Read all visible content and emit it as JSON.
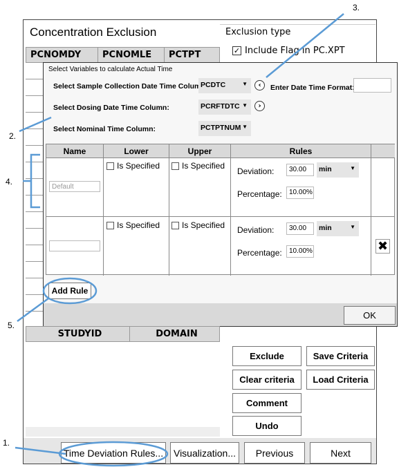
{
  "window": {
    "title": "Concentration Exclusion"
  },
  "top_grid": {
    "columns": [
      "PCNOMDY",
      "PCNOMLE",
      "PCTPT"
    ]
  },
  "exclusion_type": {
    "label": "Exclusion type",
    "include_flag": {
      "label": "Include Flag in PC.XPT",
      "checked": true
    }
  },
  "dialog": {
    "group_label": "Select Variables to calculate Actual Time",
    "sample_label": "Select Sample Collection Date Time Column:",
    "sample_value": "PCDTC",
    "dosing_label": "Select Dosing Date Time Column:",
    "dosing_value": "PCRFTDTC",
    "nominal_label": "Select Nominal Time Column:",
    "nominal_value": "PCTPTNUM",
    "format_label": "Enter Date Time Format:",
    "format_value": "",
    "table": {
      "headers": [
        "Name",
        "Lower",
        "Upper",
        "Rules",
        ""
      ],
      "rows": [
        {
          "name_placeholder": "Default",
          "lower": "Is Specified",
          "upper": "Is Specified",
          "deviation_label": "Deviation:",
          "deviation": "30.00",
          "unit": "min",
          "percentage_label": "Percentage:",
          "percentage": "10.00%"
        },
        {
          "name_placeholder": "",
          "lower": "Is Specified",
          "upper": "Is Specified",
          "deviation_label": "Deviation:",
          "deviation": "30.00",
          "unit": "min",
          "percentage_label": "Percentage:",
          "percentage": "10.00%"
        }
      ]
    },
    "add_rule": "Add Rule",
    "ok": "OK"
  },
  "bottom_grid": {
    "columns": [
      "STUDYID",
      "DOMAIN"
    ]
  },
  "actions": {
    "exclude": "Exclude",
    "save": "Save Criteria",
    "clear": "Clear criteria",
    "load": "Load Criteria",
    "comment": "Comment",
    "undo": "Undo"
  },
  "footer": {
    "time_dev": "Time Deviation Rules...",
    "visualization": "Visualization...",
    "previous": "Previous",
    "next": "Next"
  },
  "annotations": {
    "n1": "1.",
    "n2": "2.",
    "n3": "3.",
    "n4": "4.",
    "n5": "5.",
    "color": "#5b9bd5"
  }
}
